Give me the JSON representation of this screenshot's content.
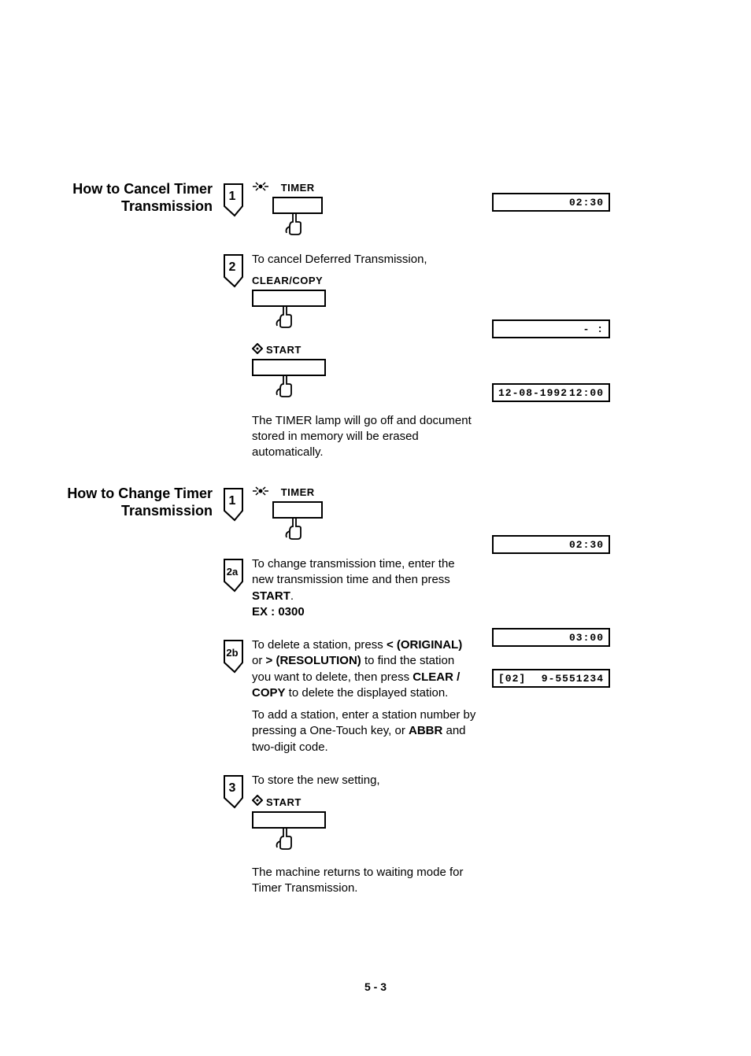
{
  "page_number": "5 - 3",
  "cancel": {
    "title_l1": "How to Cancel Timer",
    "title_l2": "Transmission",
    "step1": {
      "num": "1",
      "button": "TIMER",
      "lcd": "02:30"
    },
    "step2": {
      "num": "2",
      "text1": "To cancel Deferred Transmission,",
      "button1": "CLEAR/COPY",
      "lcd1": "- :",
      "button2": "START",
      "lcd2_date": "12-08-1992",
      "lcd2_time": "12:00",
      "text2": "The TIMER lamp will go off and document stored in memory will be erased automatically."
    }
  },
  "change": {
    "title_l1": "How to Change Timer",
    "title_l2": "Transmission",
    "step1": {
      "num": "1",
      "button": "TIMER",
      "lcd": "02:30"
    },
    "step2a": {
      "num": "2a",
      "text": "To change transmission time, enter the new transmission time and then press ",
      "bold1": "START",
      "text2": ".",
      "ex_label": "EX : ",
      "ex_value": "0300",
      "lcd": "03:00"
    },
    "step2b": {
      "num": "2b",
      "t1": "To delete a station, press ",
      "t2": "< (ORIGINAL)",
      "t3": " or ",
      "t4": "> (RESOLUTION)",
      "t5": " to find the station you want to delete, then press ",
      "t6": "CLEAR / COPY",
      "t7": " to delete the displayed station.",
      "lcd_code": "[02]",
      "lcd_num": "9-5551234",
      "add_t1": "To add a station, enter a station number by pressing a One-Touch key, or ",
      "add_t2": "ABBR",
      "add_t3": " and two-digit code."
    },
    "step3": {
      "num": "3",
      "text1": "To store the new setting,",
      "button": "START",
      "text2": "The machine returns to waiting mode for Timer Transmission."
    }
  }
}
